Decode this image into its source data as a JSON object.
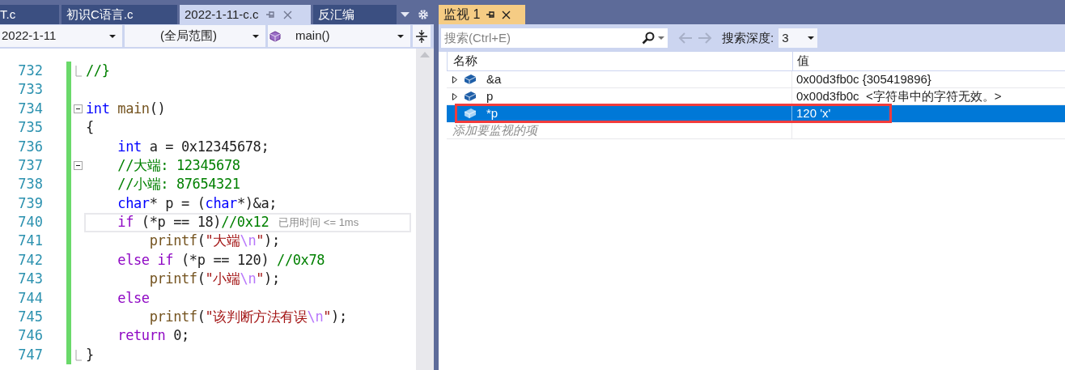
{
  "editor": {
    "tabs": [
      {
        "label": "T.c",
        "selected": false,
        "pinnable": false
      },
      {
        "label": "初识C语言.c",
        "selected": false,
        "pinnable": false
      },
      {
        "label": "2022-1-11-c.c",
        "selected": true,
        "pinnable": true
      },
      {
        "label": "反汇编",
        "selected": false,
        "pinnable": false
      }
    ],
    "navigation": {
      "project": "2022-1-11",
      "scope": "(全局范围)",
      "member": "main()"
    },
    "lines": [
      {
        "number": "732",
        "fold_end": true,
        "tokens": [
          {
            "kind": "comment",
            "text": "//}"
          }
        ]
      },
      {
        "number": "733"
      },
      {
        "number": "734",
        "collapsible": true,
        "tokens": [
          {
            "kind": "keyword",
            "text": "int"
          },
          {
            "kind": "function",
            "text": " main"
          },
          {
            "kind": "plain",
            "text": "()"
          }
        ]
      },
      {
        "number": "735",
        "tokens": [
          {
            "kind": "plain",
            "text": "{"
          }
        ]
      },
      {
        "number": "736",
        "tokens": [
          {
            "kind": "keyword",
            "text": "    int"
          },
          {
            "kind": "plain",
            "text": " a = 0x12345678;"
          }
        ]
      },
      {
        "number": "737",
        "collapsible": true,
        "tokens": [
          {
            "kind": "comment",
            "text": "    //大端: 12345678"
          }
        ]
      },
      {
        "number": "738",
        "tokens": [
          {
            "kind": "comment",
            "text": "    //小端: 87654321"
          }
        ]
      },
      {
        "number": "739",
        "tokens": [
          {
            "kind": "keyword",
            "text": "    char"
          },
          {
            "kind": "plain",
            "text": "* p = ("
          },
          {
            "kind": "keyword",
            "text": "char"
          },
          {
            "kind": "plain",
            "text": "*)&a;"
          }
        ]
      },
      {
        "number": "740",
        "current": true,
        "hint": "已用时间 <= 1ms",
        "tokens": [
          {
            "kind": "control",
            "text": "    if"
          },
          {
            "kind": "plain",
            "text": " (*p == 18)"
          },
          {
            "kind": "comment",
            "text": "//0x12"
          }
        ]
      },
      {
        "number": "741",
        "tokens": [
          {
            "kind": "function",
            "text": "        printf"
          },
          {
            "kind": "plain",
            "text": "("
          },
          {
            "kind": "string",
            "text": "\"大端"
          },
          {
            "kind": "escape",
            "text": "\\n"
          },
          {
            "kind": "string",
            "text": "\""
          },
          {
            "kind": "plain",
            "text": ");"
          }
        ]
      },
      {
        "number": "742",
        "tokens": [
          {
            "kind": "control",
            "text": "    else"
          },
          {
            "kind": "control",
            "text": " if"
          },
          {
            "kind": "plain",
            "text": " (*p == 120) "
          },
          {
            "kind": "comment",
            "text": "//0x78"
          }
        ]
      },
      {
        "number": "743",
        "tokens": [
          {
            "kind": "function",
            "text": "        printf"
          },
          {
            "kind": "plain",
            "text": "("
          },
          {
            "kind": "string",
            "text": "\"小端"
          },
          {
            "kind": "escape",
            "text": "\\n"
          },
          {
            "kind": "string",
            "text": "\""
          },
          {
            "kind": "plain",
            "text": ");"
          }
        ]
      },
      {
        "number": "744",
        "tokens": [
          {
            "kind": "control",
            "text": "    else"
          }
        ]
      },
      {
        "number": "745",
        "tokens": [
          {
            "kind": "function",
            "text": "        printf"
          },
          {
            "kind": "plain",
            "text": "("
          },
          {
            "kind": "string",
            "text": "\"该判断方法有误"
          },
          {
            "kind": "escape",
            "text": "\\n"
          },
          {
            "kind": "string",
            "text": "\""
          },
          {
            "kind": "plain",
            "text": ");"
          }
        ]
      },
      {
        "number": "746",
        "tokens": [
          {
            "kind": "control",
            "text": "    return"
          },
          {
            "kind": "plain",
            "text": " 0;"
          }
        ]
      },
      {
        "number": "747",
        "fold_end": true,
        "tokens": [
          {
            "kind": "plain",
            "text": "}"
          }
        ]
      }
    ]
  },
  "watch": {
    "title": "监视 1",
    "search": {
      "placeholder": "搜索(Ctrl+E)"
    },
    "depth_label": "搜索深度:",
    "depth": "3",
    "columns": [
      "名称",
      "值"
    ],
    "rows": [
      {
        "name": "&a",
        "value": "0x00d3fb0c {305419896}",
        "expandable": true,
        "selected": false,
        "annotated": false
      },
      {
        "name": "p",
        "value": "0x00d3fb0c  <字符串中的字符无效。>",
        "expandable": true,
        "selected": false,
        "annotated": false
      },
      {
        "name": "*p",
        "value": "120 'x'",
        "expandable": false,
        "selected": true,
        "annotated": true
      }
    ],
    "add_placeholder": "添加要监视的项"
  }
}
